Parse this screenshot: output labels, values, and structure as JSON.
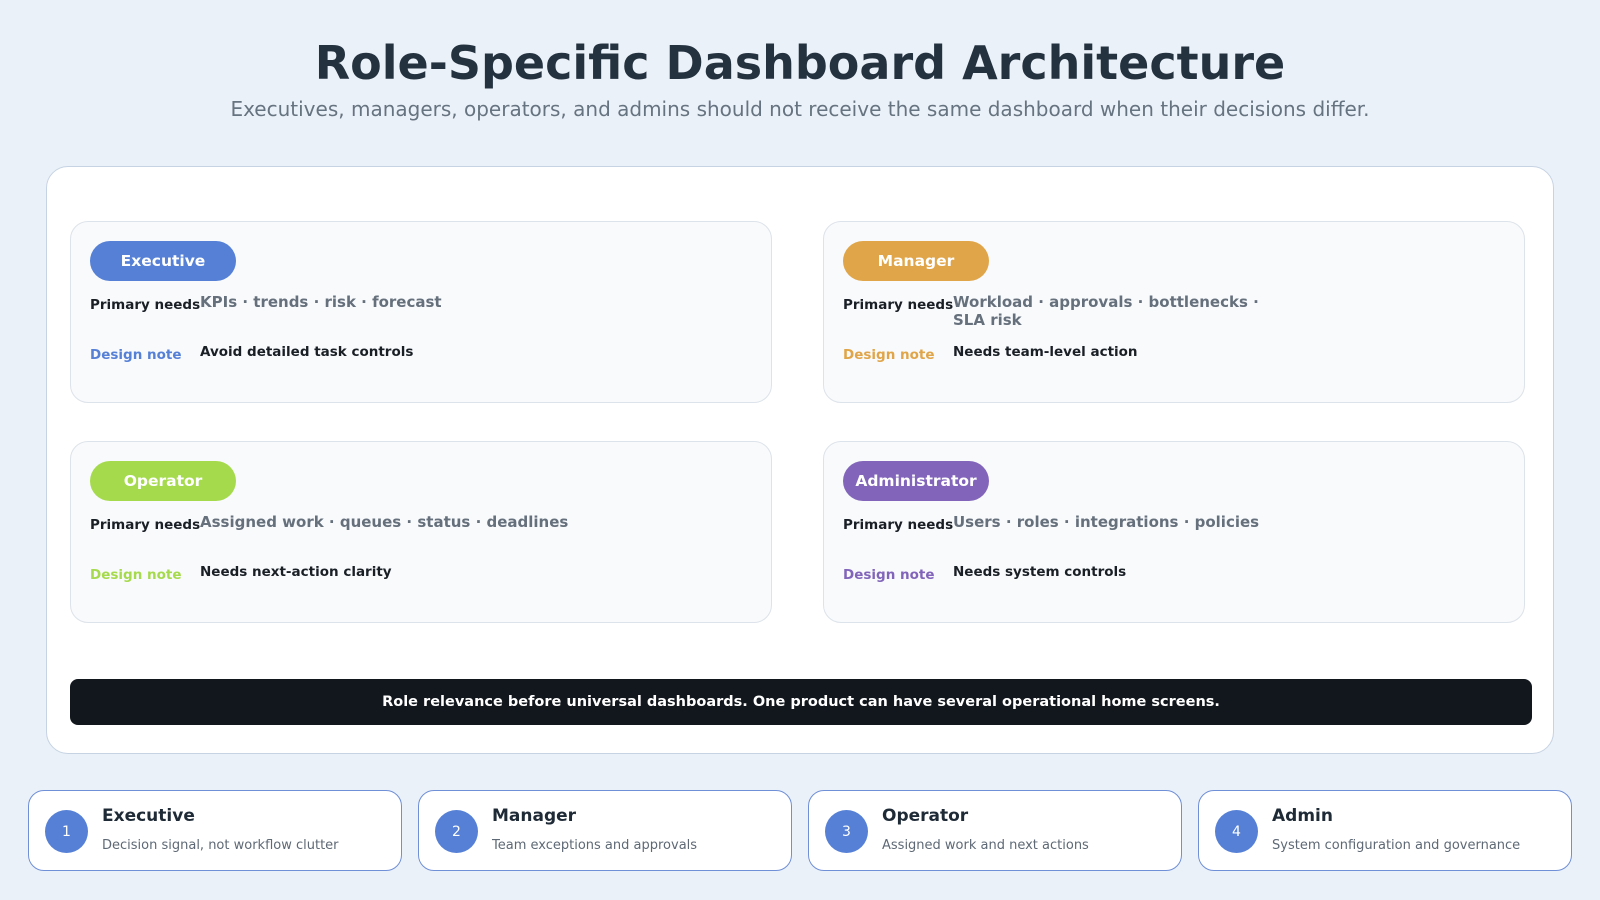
{
  "header": {
    "title": "Role-Specific Dashboard Architecture",
    "subtitle": "Executives, managers, operators, and admins should not receive the same dashboard when their decisions differ."
  },
  "labels": {
    "primary_needs": "Primary needs",
    "design_note": "Design note"
  },
  "roles": [
    {
      "name": "Executive",
      "color": "#5580d6",
      "needs": "KPIs · trends · risk · forecast",
      "note": "Avoid detailed task controls"
    },
    {
      "name": "Manager",
      "color": "#e0a548",
      "needs": "Workload · approvals · bottlenecks · SLA risk",
      "note": "Needs team-level action"
    },
    {
      "name": "Operator",
      "color": "#a6da4d",
      "needs": "Assigned work · queues · status · deadlines",
      "note": "Needs next-action clarity"
    },
    {
      "name": "Administrator",
      "color": "#8265ba",
      "needs": "Users · roles · integrations · policies",
      "note": "Needs system controls"
    }
  ],
  "banner": {
    "text": "Role relevance before universal dashboards. One product can have several operational home screens."
  },
  "summary": [
    {
      "number": "1",
      "title": "Executive",
      "desc": "Decision signal, not workflow clutter"
    },
    {
      "number": "2",
      "title": "Manager",
      "desc": "Team exceptions and approvals"
    },
    {
      "number": "3",
      "title": "Operator",
      "desc": "Assigned work and next actions"
    },
    {
      "number": "4",
      "title": "Admin",
      "desc": "System configuration and governance"
    }
  ]
}
